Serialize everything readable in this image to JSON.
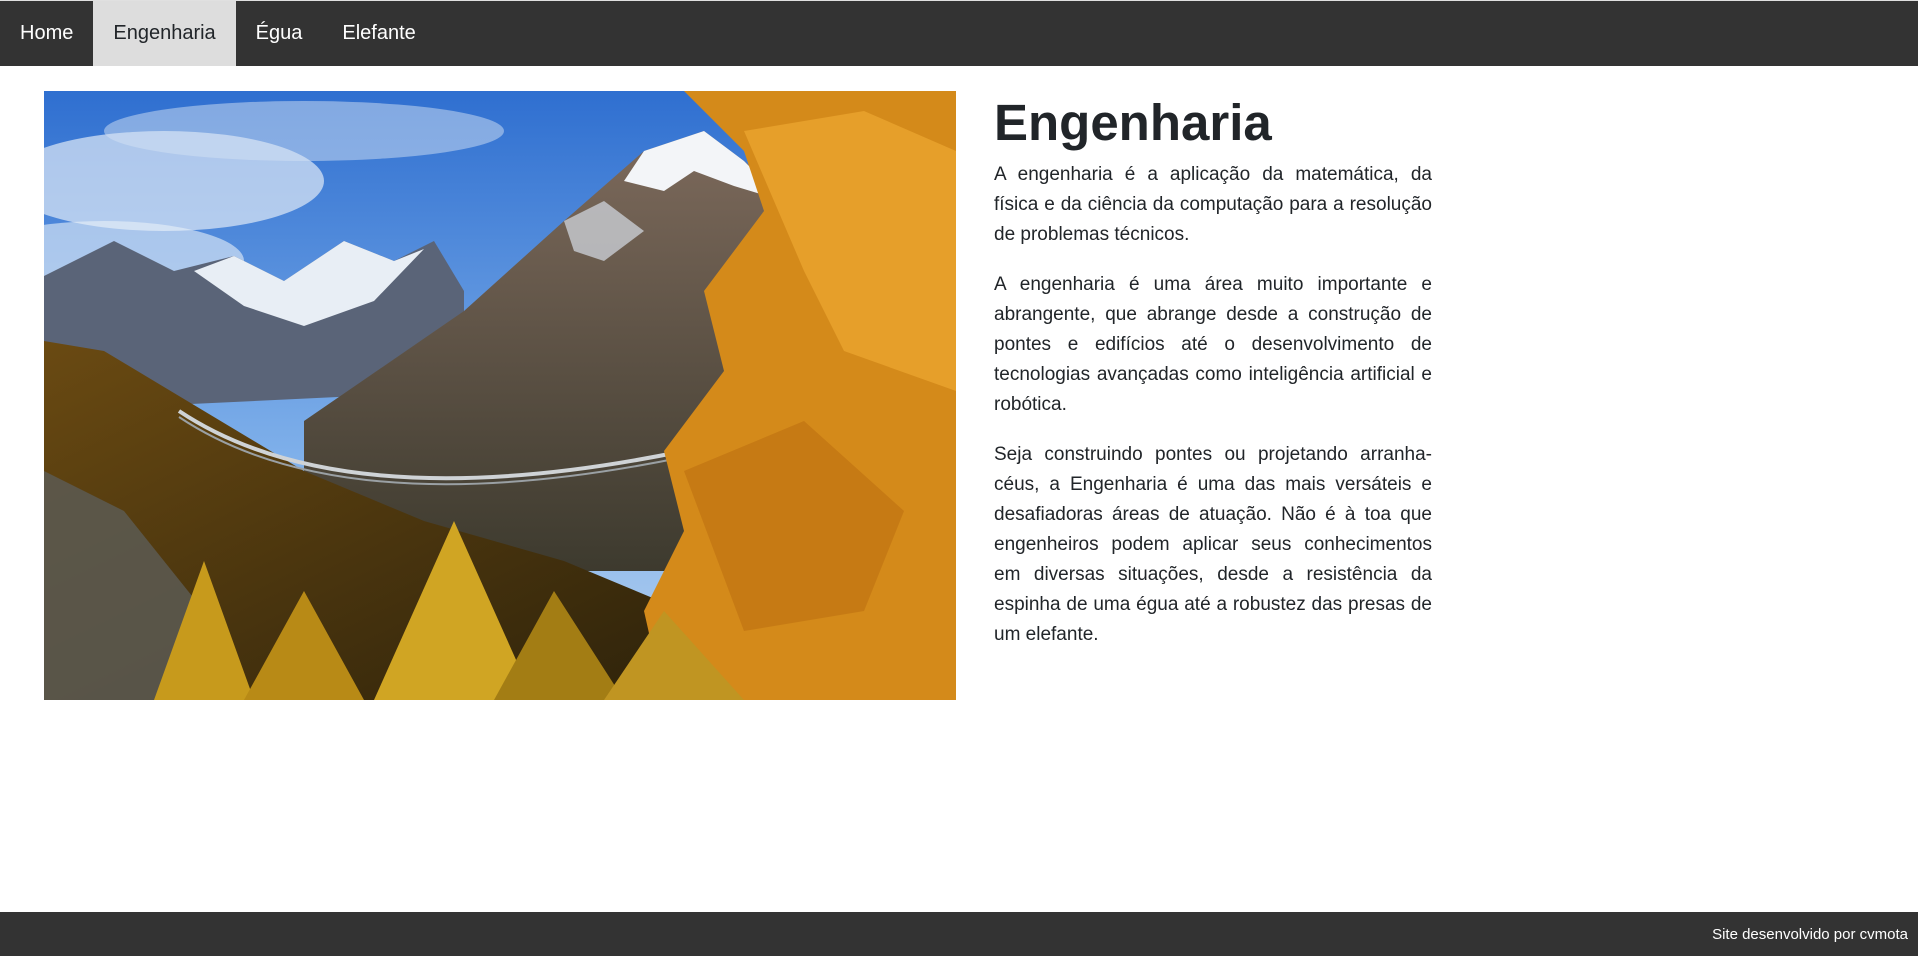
{
  "nav": {
    "items": [
      {
        "label": "Home",
        "active": false
      },
      {
        "label": "Engenharia",
        "active": true
      },
      {
        "label": "Égua",
        "active": false
      },
      {
        "label": "Elefante",
        "active": false
      }
    ]
  },
  "hero": {
    "icon": "mountain-suspension-bridge-photo"
  },
  "main": {
    "title": "Engenharia",
    "paragraphs": [
      "A engenharia é a aplicação da matemática, da física e da ciência da computação para a resolução de problemas técnicos.",
      "A engenharia é uma área muito importante e abrangente, que abrange desde a construção de pontes e edifícios até o desenvolvimento de tecnologias avançadas como inteligência artificial e robótica.",
      "Seja construindo pontes ou projetando arranha-céus, a Engenharia é uma das mais versáteis e desafiadoras áreas de atuação. Não é à toa que engenheiros podem aplicar seus conhecimentos em diversas situações, desde a resistência da espinha de uma égua até a robustez das presas de um elefante."
    ]
  },
  "footer": {
    "text": "Site desenvolvido por cvmota"
  },
  "colors": {
    "navbar": "#333333",
    "nav_active": "#dddddd",
    "footer": "#333333"
  }
}
